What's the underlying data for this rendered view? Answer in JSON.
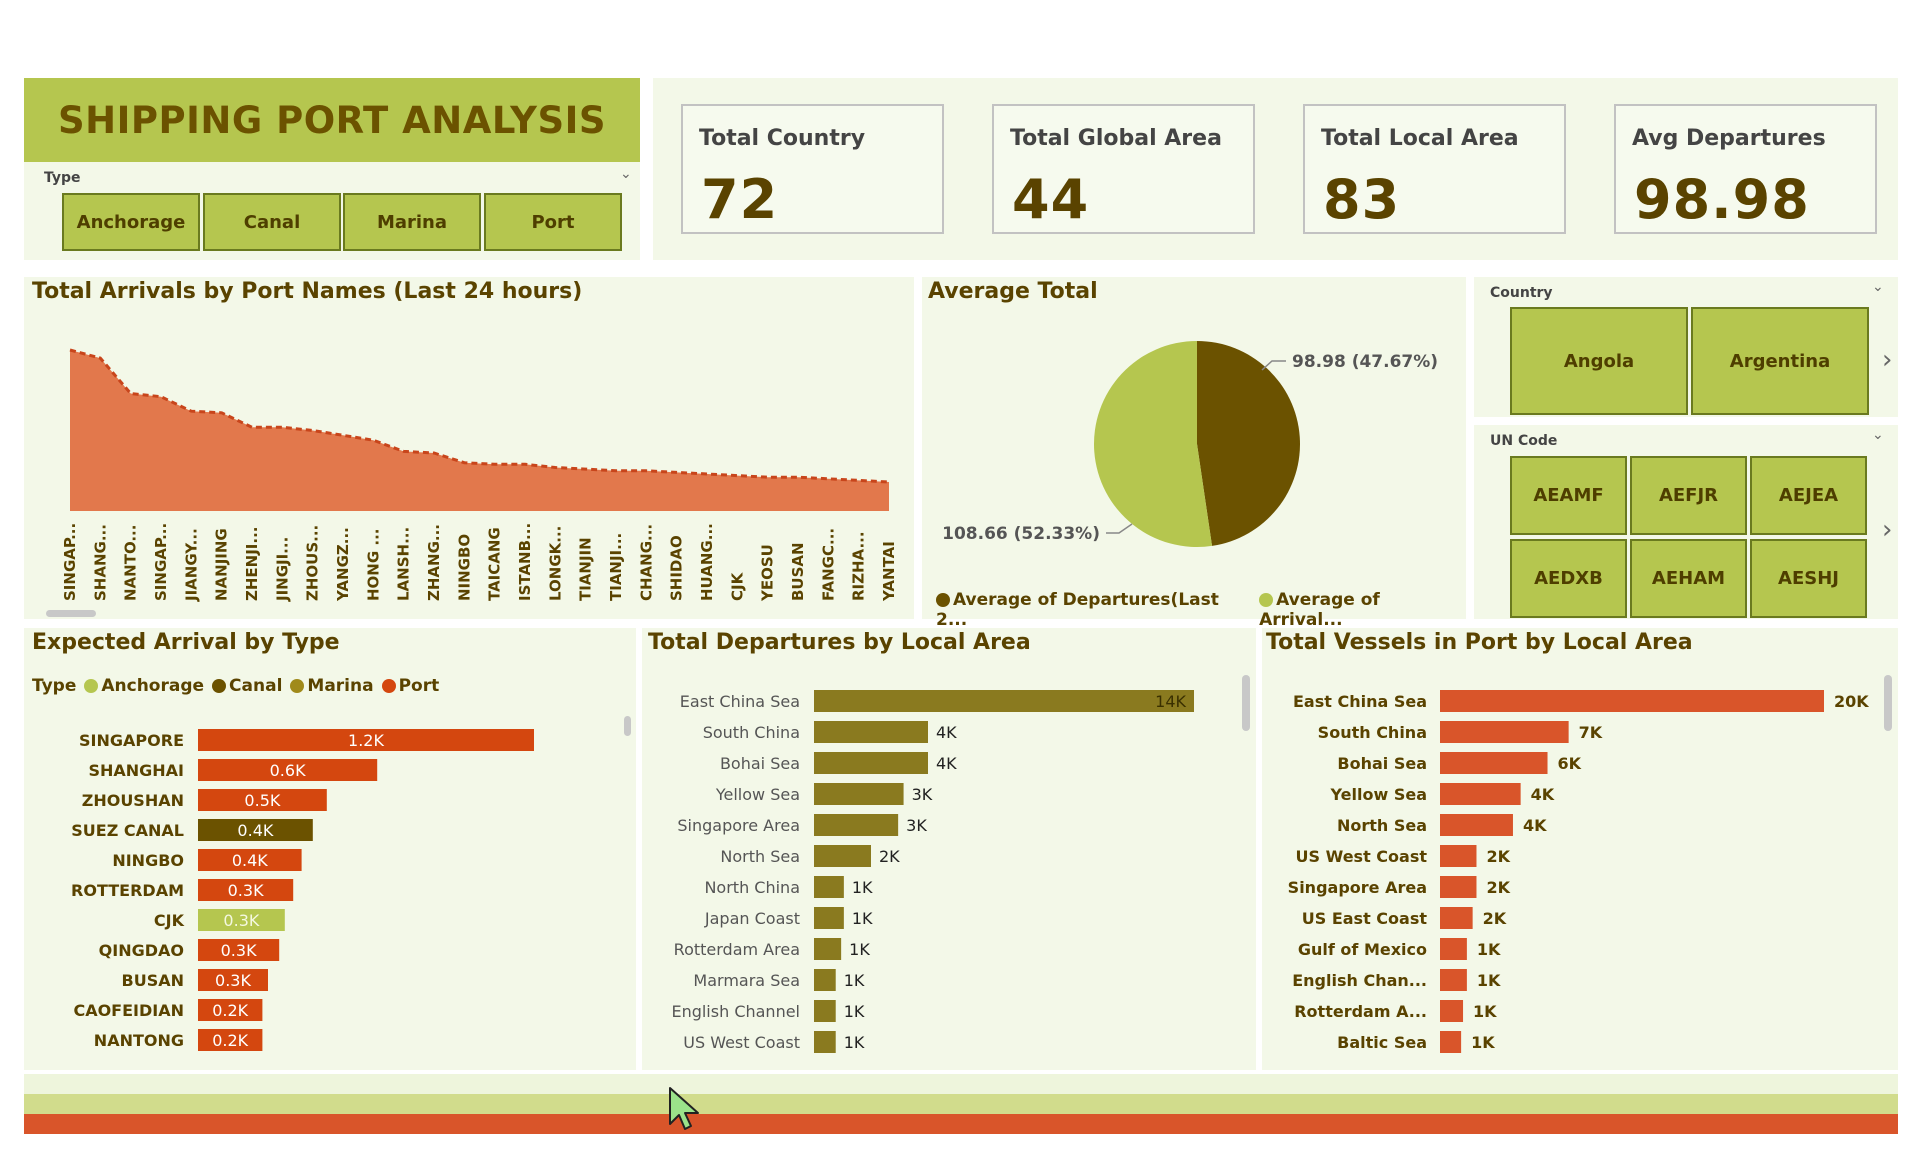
{
  "header": {
    "title": "SHIPPING PORT ANALYSIS"
  },
  "type_slicer": {
    "label": "Type",
    "options": [
      "Anchorage",
      "Canal",
      "Marina",
      "Port"
    ]
  },
  "kpis": [
    {
      "label": "Total Country",
      "value": "72"
    },
    {
      "label": "Total Global Area",
      "value": "44"
    },
    {
      "label": "Total Local Area",
      "value": "83"
    },
    {
      "label": "Avg Departures",
      "value": "98.98"
    }
  ],
  "country_slicer": {
    "label": "Country",
    "options": [
      "Angola",
      "Argentina"
    ]
  },
  "uncode_slicer": {
    "label": "UN Code",
    "options": [
      "AEAMF",
      "AEFJR",
      "AEJEA",
      "AEDXB",
      "AEHAM",
      "AESHJ"
    ]
  },
  "colors": {
    "olive_dark": "#6b5200",
    "lime": "#b5c64f",
    "orange": "#d9552a",
    "port_red": "#d4470f",
    "departure_bar": "#8a7a1f",
    "area_fill": "#e2784c"
  },
  "chart_data": [
    {
      "type": "area",
      "title": "Total Arrivals by Port Names (Last 24 hours)",
      "categories": [
        "SINGAP...",
        "SHANG...",
        "NANTO...",
        "SINGAP...",
        "JIANGY...",
        "NANJING",
        "ZHENJI...",
        "JINGJI...",
        "ZHOUS...",
        "YANGZ...",
        "HONG ...",
        "LANSH...",
        "ZHANG...",
        "NINGBO",
        "TAICANG",
        "ISTANB...",
        "LONGK...",
        "TIANJIN",
        "TIANJI...",
        "CHANG...",
        "SHIDAO",
        "HUANG...",
        "CJK",
        "YEOSU",
        "BUSAN",
        "FANGC...",
        "RIZHA...",
        "YANTAI"
      ],
      "values": [
        1.0,
        0.95,
        0.73,
        0.71,
        0.62,
        0.61,
        0.52,
        0.52,
        0.5,
        0.47,
        0.44,
        0.37,
        0.36,
        0.3,
        0.29,
        0.29,
        0.27,
        0.26,
        0.25,
        0.25,
        0.24,
        0.23,
        0.22,
        0.21,
        0.21,
        0.2,
        0.19,
        0.18
      ],
      "style": "dashed line over filled area",
      "ylim": [
        0,
        1
      ]
    },
    {
      "type": "pie",
      "title": "Average Total",
      "slices": [
        {
          "name": "Average of Departures(Last 2...",
          "value": 98.98,
          "label": "98.98 (47.67%)",
          "color": "#6b5200"
        },
        {
          "name": "Average of Arrival...",
          "value": 108.66,
          "label": "108.66 (52.33%)",
          "color": "#b5c64f"
        }
      ],
      "legend_placement": "bottom"
    },
    {
      "type": "bar",
      "orientation": "horizontal",
      "title": "Expected Arrival by Type",
      "legend": {
        "label": "Type",
        "items": [
          {
            "name": "Anchorage",
            "color": "#b5c64f"
          },
          {
            "name": "Canal",
            "color": "#6b5200"
          },
          {
            "name": "Marina",
            "color": "#a08a1a"
          },
          {
            "name": "Port",
            "color": "#d4470f"
          }
        ]
      },
      "categories": [
        "SINGAPORE",
        "SHANGHAI",
        "ZHOUSHAN",
        "SUEZ CANAL",
        "NINGBO",
        "ROTTERDAM",
        "CJK",
        "QINGDAO",
        "BUSAN",
        "CAOFEIDIAN",
        "NANTONG"
      ],
      "values": [
        1.2,
        0.6,
        0.5,
        0.4,
        0.4,
        0.3,
        0.3,
        0.3,
        0.3,
        0.2,
        0.2
      ],
      "scaled": [
        1.2,
        0.64,
        0.46,
        0.41,
        0.37,
        0.34,
        0.31,
        0.29,
        0.25,
        0.23,
        0.23
      ],
      "data_labels": [
        "1.2K",
        "0.6K",
        "0.5K",
        "0.4K",
        "0.4K",
        "0.3K",
        "0.3K",
        "0.3K",
        "0.3K",
        "0.2K",
        "0.2K"
      ],
      "series_type": [
        "Port",
        "Port",
        "Port",
        "Canal",
        "Port",
        "Port",
        "Anchorage",
        "Port",
        "Port",
        "Port",
        "Port"
      ],
      "units": "K"
    },
    {
      "type": "bar",
      "orientation": "horizontal",
      "title": "Total Departures by Local Area",
      "categories": [
        "East China Sea",
        "South China",
        "Bohai Sea",
        "Yellow Sea",
        "Singapore Area",
        "North Sea",
        "North China",
        "Japan Coast",
        "Rotterdam Area",
        "Marmara Sea",
        "English Channel",
        "US West Coast"
      ],
      "values": [
        14,
        4.2,
        4.2,
        3.3,
        3.1,
        2.1,
        1.1,
        1.1,
        1.0,
        0.8,
        0.8,
        0.8
      ],
      "data_labels": [
        "14K",
        "4K",
        "4K",
        "3K",
        "3K",
        "2K",
        "1K",
        "1K",
        "1K",
        "1K",
        "1K",
        "1K"
      ],
      "units": "K"
    },
    {
      "type": "bar",
      "orientation": "horizontal",
      "title": "Total Vessels in Port by Local Area",
      "categories": [
        "East China Sea",
        "South China",
        "Bohai Sea",
        "Yellow Sea",
        "North Sea",
        "US West Coast",
        "Singapore Area",
        "US East Coast",
        "Gulf of Mexico",
        "English Chan...",
        "Rotterdam A...",
        "Baltic Sea"
      ],
      "values": [
        20,
        6.7,
        5.6,
        4.2,
        3.8,
        1.9,
        1.9,
        1.7,
        1.4,
        1.4,
        1.2,
        1.1
      ],
      "data_labels": [
        "20K",
        "7K",
        "6K",
        "4K",
        "4K",
        "2K",
        "2K",
        "2K",
        "1K",
        "1K",
        "1K",
        "1K"
      ],
      "units": "K"
    }
  ]
}
